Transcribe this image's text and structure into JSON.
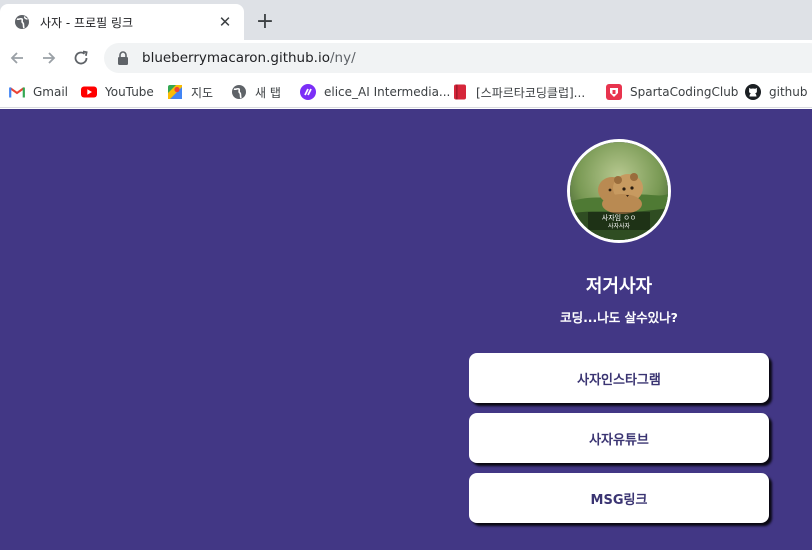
{
  "tab": {
    "title": "사자 - 프로필 링크",
    "close": "✕",
    "new_tab": "+"
  },
  "toolbar": {
    "url_host": "blueberrymacaron.github.io",
    "url_path": "/ny/"
  },
  "bookmarks": [
    {
      "label": "Gmail",
      "icon": "gmail-icon"
    },
    {
      "label": "YouTube",
      "icon": "youtube-icon"
    },
    {
      "label": "지도",
      "icon": "maps-icon"
    },
    {
      "label": "새 탭",
      "icon": "globe-icon"
    },
    {
      "label": "elice_AI Intermedia...",
      "icon": "elice-icon"
    },
    {
      "label": "[스파르타코딩클럽]...",
      "icon": "bookmark-icon"
    },
    {
      "label": "SpartaCodingClub",
      "icon": "sparta-icon"
    },
    {
      "label": "github",
      "icon": "github-icon"
    }
  ],
  "profile": {
    "avatar_caption_line1": "사자임 ㅇㅇ",
    "avatar_caption_line2": "사자사자",
    "name": "저거사자",
    "bio": "코딩...나도 살수있나?"
  },
  "links": [
    {
      "label": "사자인스타그램"
    },
    {
      "label": "사자유튜브"
    },
    {
      "label": "MSG링크"
    }
  ],
  "colors": {
    "page_background": "#423785",
    "button_text": "#3a3472",
    "tabstrip": "#dee1e6"
  }
}
